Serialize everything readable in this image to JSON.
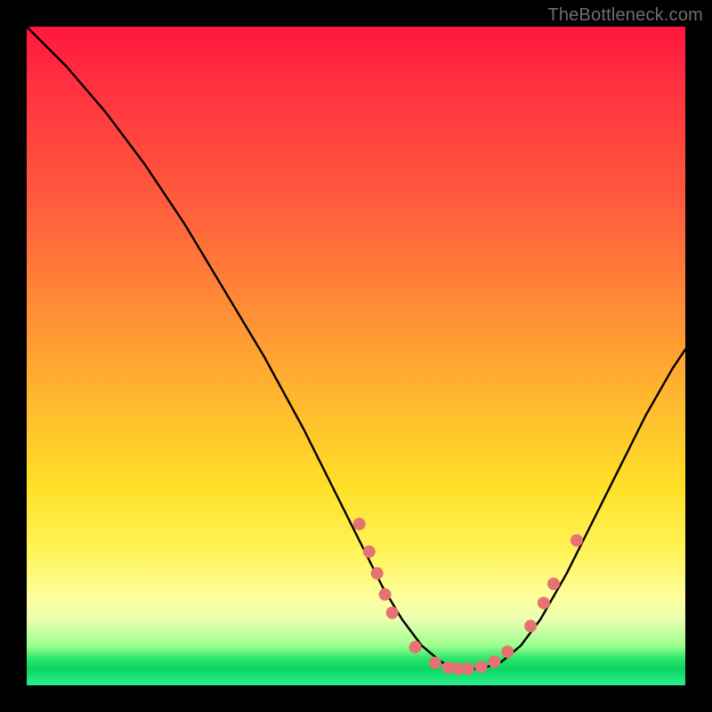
{
  "watermark": "TheBottleneck.com",
  "chart_data": {
    "type": "line",
    "title": "",
    "xlabel": "",
    "ylabel": "",
    "xlim": [
      0,
      100
    ],
    "ylim": [
      0,
      100
    ],
    "series": [
      {
        "name": "curve",
        "x": [
          0,
          6,
          12,
          18,
          24,
          30,
          36,
          42,
          48,
          51,
          54,
          57,
          60,
          63,
          66,
          69,
          72,
          75,
          78,
          82,
          86,
          90,
          94,
          98,
          100
        ],
        "y": [
          100,
          94,
          87,
          79,
          70,
          60,
          50,
          39,
          27,
          21,
          15,
          10,
          6,
          3.5,
          2.5,
          2.5,
          3.5,
          6,
          10,
          17,
          25,
          33,
          41,
          48,
          51
        ]
      }
    ],
    "markers": [
      {
        "x": 50.5,
        "y": 24.5
      },
      {
        "x": 52.0,
        "y": 20.3
      },
      {
        "x": 53.2,
        "y": 17.0
      },
      {
        "x": 54.4,
        "y": 13.8
      },
      {
        "x": 55.5,
        "y": 11.0
      },
      {
        "x": 59.0,
        "y": 5.8
      },
      {
        "x": 62.0,
        "y": 3.4
      },
      {
        "x": 64.0,
        "y": 2.7
      },
      {
        "x": 65.5,
        "y": 2.5
      },
      {
        "x": 67.0,
        "y": 2.5
      },
      {
        "x": 69.0,
        "y": 2.8
      },
      {
        "x": 71.0,
        "y": 3.6
      },
      {
        "x": 73.0,
        "y": 5.1
      },
      {
        "x": 76.5,
        "y": 9.0
      },
      {
        "x": 78.5,
        "y": 12.5
      },
      {
        "x": 80.0,
        "y": 15.4
      },
      {
        "x": 83.5,
        "y": 22.0
      }
    ],
    "marker_color": "#e57373",
    "curve_color": "#000000"
  }
}
